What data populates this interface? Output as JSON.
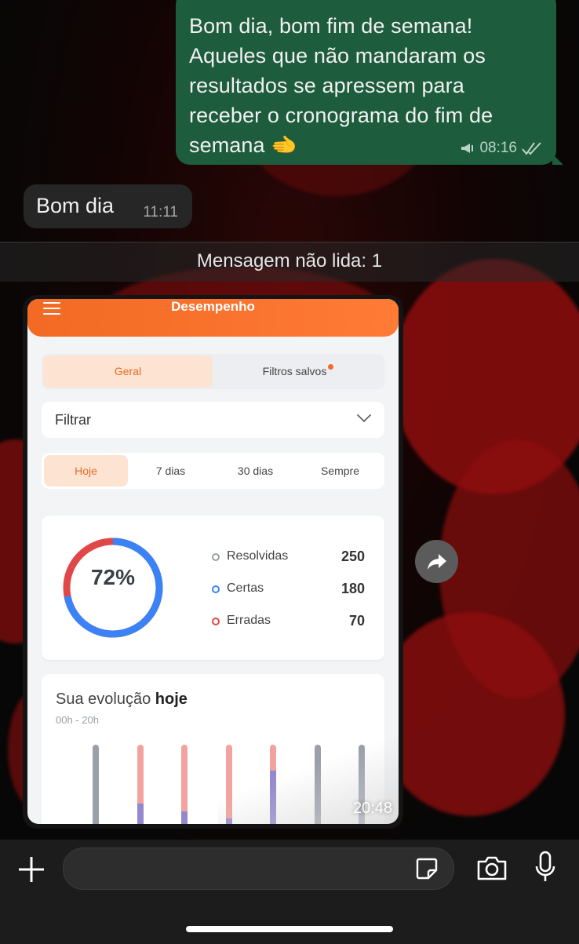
{
  "chat": {
    "outgoing": {
      "text": "Bom dia, bom fim de semana! Aqueles que não mandaram os resultados se apressem para receber o cronograma do fim de semana",
      "emoji": "🫲",
      "time": "08:16",
      "status": "read-double-check"
    },
    "incoming": {
      "text": "Bom dia",
      "time": "11:11"
    },
    "unread_banner": "Mensagem não lida: 1",
    "image_message": {
      "time": "20:48"
    }
  },
  "app": {
    "title": "Desempenho",
    "tabs": [
      "Geral",
      "Filtros salvos"
    ],
    "filter_label": "Filtrar",
    "periods": [
      "Hoje",
      "7 dias",
      "30 dias",
      "Sempre"
    ],
    "percent_label": "72%",
    "stats": [
      {
        "label": "Resolvidas",
        "value": "250",
        "color": "#9aa0a6"
      },
      {
        "label": "Certas",
        "value": "180",
        "color": "#3b82f6"
      },
      {
        "label": "Erradas",
        "value": "70",
        "color": "#e04848"
      }
    ],
    "evolution": {
      "title_prefix": "Sua evolução",
      "title_bold": "hoje",
      "subtitle": "00h - 20h"
    }
  },
  "chart_data": {
    "type": "bar",
    "note_visible": "stacked bars, cropped at bottom",
    "bars": [
      {
        "kind": "gray"
      },
      {
        "kind": "stacked",
        "red_fraction": 0.58,
        "purple_fraction": 0.42
      },
      {
        "kind": "stacked",
        "red_fraction": 0.65,
        "purple_fraction": 0.35
      },
      {
        "kind": "stacked",
        "red_fraction": 0.72,
        "purple_fraction": 0.28
      },
      {
        "kind": "stacked",
        "red_fraction": 0.25,
        "purple_fraction": 0.75
      },
      {
        "kind": "gray"
      },
      {
        "kind": "gray"
      }
    ],
    "donut": {
      "correct_fraction": 0.72,
      "correct_color": "#3b82f6",
      "wrong_color": "#e04848"
    }
  },
  "icons": {
    "forward": "forward-arrow-icon",
    "plus": "plus-icon",
    "sticker": "sticker-icon",
    "camera": "camera-icon",
    "mic": "microphone-icon"
  }
}
